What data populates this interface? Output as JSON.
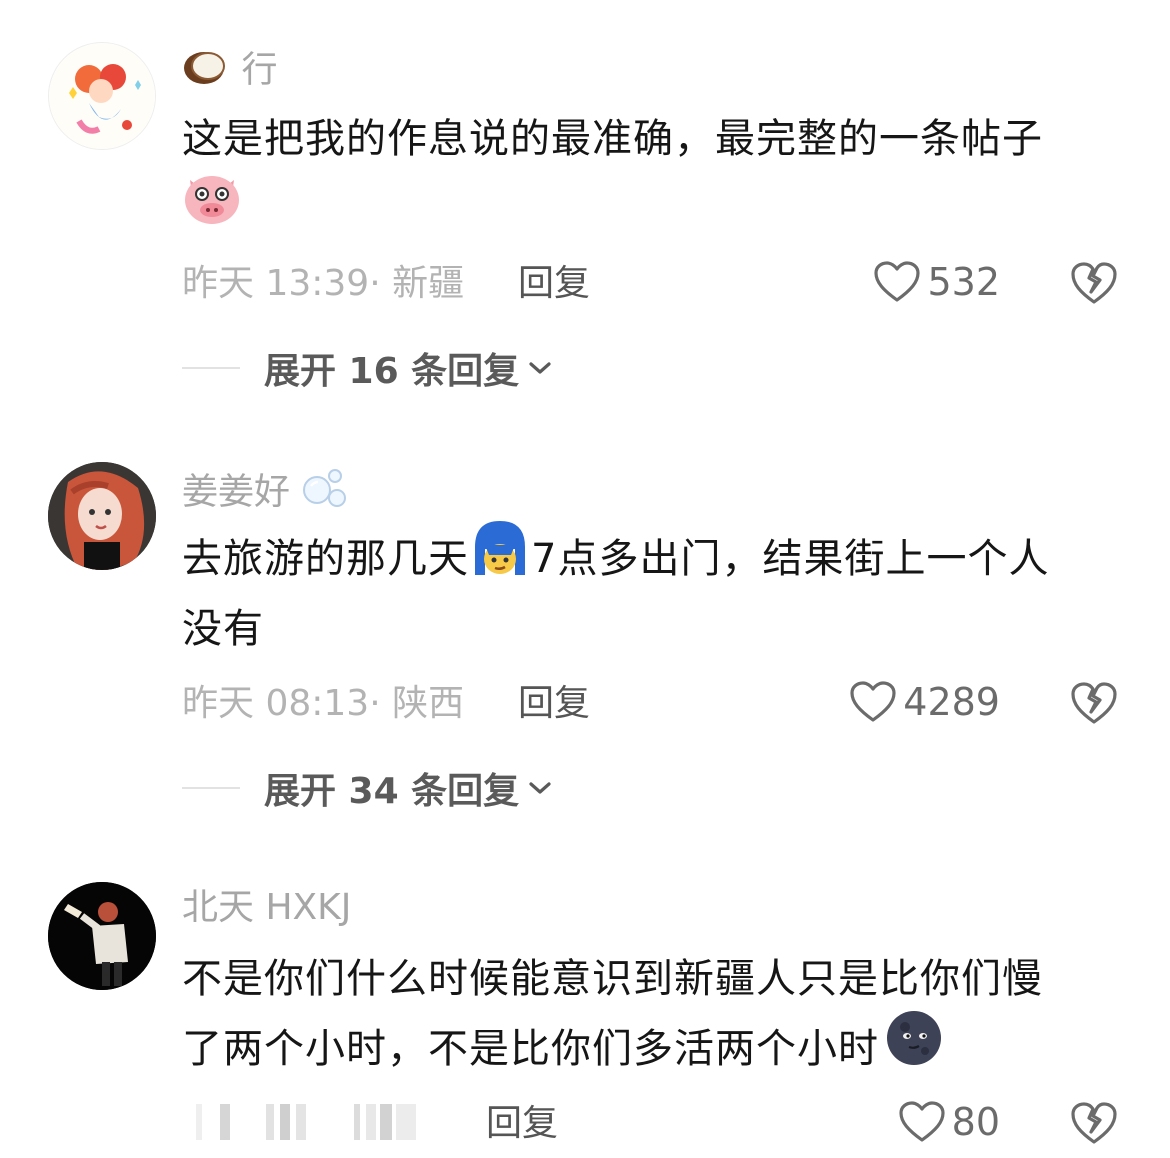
{
  "comments": [
    {
      "username": "行",
      "username_icon": "coconut-icon",
      "text_line1": "这是把我的作息说的最准确，最完整的一条帖子",
      "trailing_emoji": "pig-face-icon",
      "time": "昨天 13:39",
      "location": "· 新疆",
      "reply_label": "回复",
      "likes": "532",
      "expand_label": "展开 16 条回复"
    },
    {
      "username": "姜姜好",
      "username_icon": "bubbles-icon",
      "text_before_emoji": "去旅游的那几天",
      "inline_emoji": "blue-hair-face-icon",
      "text_after_emoji": "7点多出门，结果街上一个人",
      "text_line2": "没有",
      "time": "昨天 08:13",
      "location": "· 陕西",
      "reply_label": "回复",
      "likes": "4289",
      "expand_label": "展开 34 条回复"
    },
    {
      "username": "北天 HXKJ",
      "text_line1": "不是你们什么时候能意识到新疆人只是比你们慢",
      "text_line2": "了两个小时，不是比你们多活两个小时",
      "trailing_emoji": "new-moon-face-icon",
      "reply_label": "回复",
      "likes": "80"
    }
  ],
  "colors": {
    "username": "#a6a6a6",
    "text": "#161616",
    "meta": "#b3b3b3",
    "accent_icon": "#6b6b6b"
  }
}
